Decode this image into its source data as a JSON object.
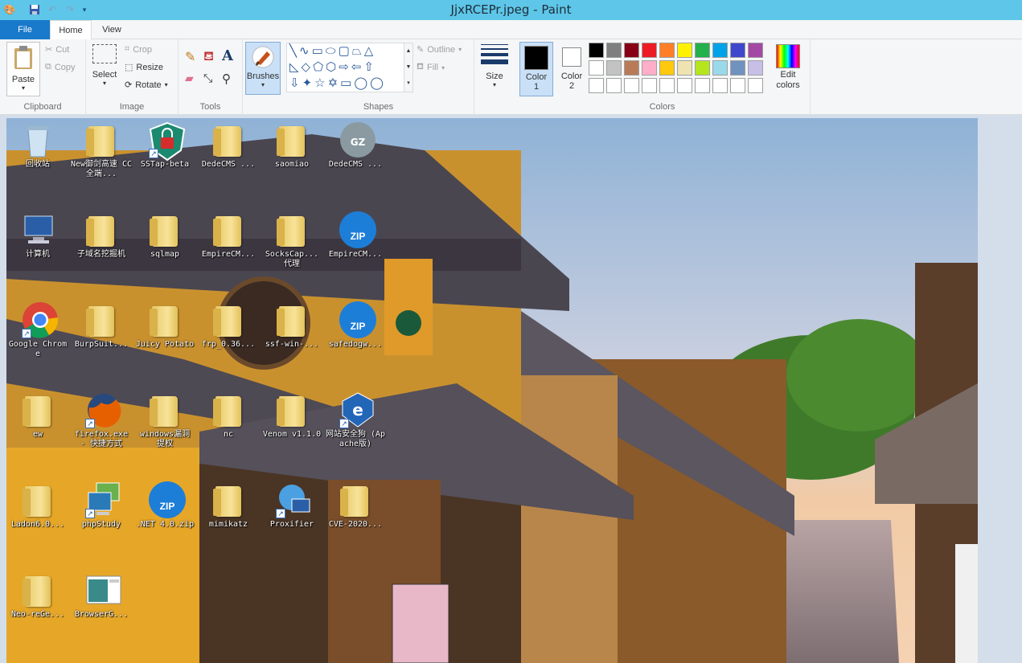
{
  "window": {
    "title": "JjxRCEPr.jpeg - Paint"
  },
  "tabs": {
    "file": "File",
    "home": "Home",
    "view": "View"
  },
  "clipboard": {
    "paste": "Paste",
    "cut": "Cut",
    "copy": "Copy",
    "label": "Clipboard"
  },
  "image_group": {
    "select": "Select",
    "crop": "Crop",
    "resize": "Resize",
    "rotate": "Rotate",
    "label": "Image"
  },
  "tools": {
    "label": "Tools"
  },
  "brushes": {
    "label": "Brushes"
  },
  "shapes": {
    "outline": "Outline",
    "fill": "Fill",
    "label": "Shapes"
  },
  "size": {
    "label": "Size"
  },
  "colors": {
    "color1_label": "Color",
    "color1_num": "1",
    "color2_label": "Color",
    "color2_num": "2",
    "edit_label": "Edit colors",
    "label": "Colors",
    "color1": "#000000",
    "color2": "#ffffff",
    "palette_row1": [
      "#000000",
      "#7f7f7f",
      "#880015",
      "#ed1c24",
      "#ff7f27",
      "#fff200",
      "#22b14c",
      "#00a2e8",
      "#3f48cc",
      "#a349a4"
    ],
    "palette_row2": [
      "#ffffff",
      "#c3c3c3",
      "#b97a57",
      "#ffaec9",
      "#ffc90e",
      "#efe4b0",
      "#b5e61d",
      "#99d9ea",
      "#7092be",
      "#c8bfe7"
    ],
    "palette_row3": [
      "#ffffff",
      "#ffffff",
      "#ffffff",
      "#ffffff",
      "#ffffff",
      "#ffffff",
      "#ffffff",
      "#ffffff",
      "#ffffff",
      "#ffffff"
    ]
  },
  "desktop_icons": [
    {
      "label": "回收站",
      "icon": "recycle-bin-icon",
      "type": "bin"
    },
    {
      "label": "New御剑高速 CC全端...",
      "icon": "folder-icon",
      "type": "folder"
    },
    {
      "label": "SSTap-beta",
      "icon": "shield-lock-icon",
      "type": "shield"
    },
    {
      "label": "DedeCMS ...",
      "icon": "folder-icon",
      "type": "folder"
    },
    {
      "label": "saomiao",
      "icon": "folder-icon",
      "type": "folder"
    },
    {
      "label": "DedeCMS ...",
      "icon": "gz-archive-icon",
      "type": "gz"
    },
    {
      "label": "计算机",
      "icon": "computer-icon",
      "type": "computer"
    },
    {
      "label": "子域名挖掘机",
      "icon": "folder-icon",
      "type": "folder"
    },
    {
      "label": "sqlmap",
      "icon": "folder-icon",
      "type": "folder"
    },
    {
      "label": "EmpireCM...",
      "icon": "folder-icon",
      "type": "folder"
    },
    {
      "label": "SocksCap... 代理",
      "icon": "folder-icon",
      "type": "folder"
    },
    {
      "label": "EmpireCM...",
      "icon": "zip-archive-icon",
      "type": "zip"
    },
    {
      "label": "Google Chrome",
      "icon": "chrome-icon",
      "type": "chrome"
    },
    {
      "label": "BurpSuit...",
      "icon": "folder-icon",
      "type": "folder"
    },
    {
      "label": "Juicy Potato",
      "icon": "folder-icon",
      "type": "folder"
    },
    {
      "label": "frp_0.36...",
      "icon": "folder-icon",
      "type": "folder"
    },
    {
      "label": "ssf-win-...",
      "icon": "folder-icon",
      "type": "folder"
    },
    {
      "label": "safedogw...",
      "icon": "zip-archive-icon",
      "type": "zip"
    },
    {
      "label": "ew",
      "icon": "folder-icon",
      "type": "folder"
    },
    {
      "label": "firefox.exe - 快捷方式",
      "icon": "firefox-icon",
      "type": "firefox"
    },
    {
      "label": "windows漏洞 提权",
      "icon": "folder-icon",
      "type": "folder"
    },
    {
      "label": "nc",
      "icon": "folder-icon",
      "type": "folder"
    },
    {
      "label": "Venom v1.1.0",
      "icon": "folder-icon",
      "type": "folder"
    },
    {
      "label": "网站安全狗 (Apache版)",
      "icon": "safedog-icon",
      "type": "safedog"
    },
    {
      "label": "Ladon6.0...",
      "icon": "folder-icon",
      "type": "folder"
    },
    {
      "label": "phpStudy",
      "icon": "phpstudy-icon",
      "type": "php"
    },
    {
      "label": ".NET 4.0.zip",
      "icon": "zip-archive-icon",
      "type": "zip"
    },
    {
      "label": "mimikatz",
      "icon": "folder-icon",
      "type": "folder"
    },
    {
      "label": "Proxifier",
      "icon": "proxifier-icon",
      "type": "proxifier"
    },
    {
      "label": "CVE-2020...",
      "icon": "folder-icon",
      "type": "folder"
    },
    {
      "label": "Neo-reGe...",
      "icon": "folder-icon",
      "type": "folder"
    },
    {
      "label": "BrowserG...",
      "icon": "browser-icon",
      "type": "browser"
    }
  ]
}
